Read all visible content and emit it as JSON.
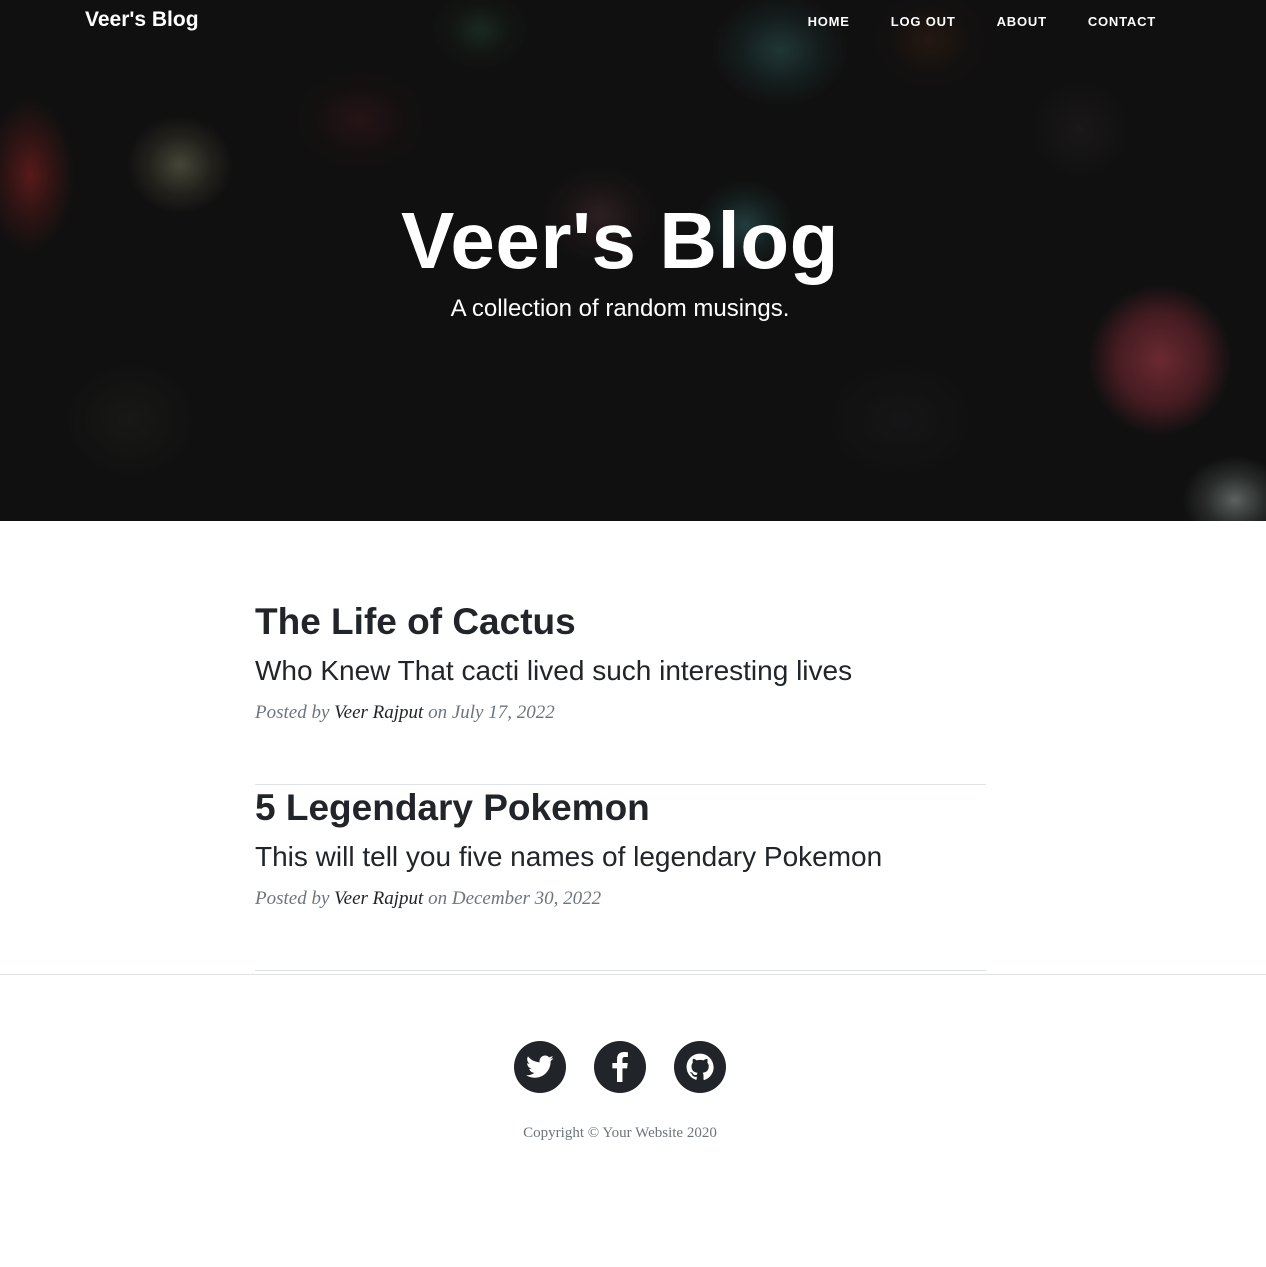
{
  "navbar": {
    "brand": "Veer's Blog",
    "links": [
      {
        "label": "HOME"
      },
      {
        "label": "LOG OUT"
      },
      {
        "label": "ABOUT"
      },
      {
        "label": "CONTACT"
      }
    ]
  },
  "hero": {
    "title": "Veer's Blog",
    "subtitle": "A collection of random musings."
  },
  "posts": [
    {
      "title": "The Life of Cactus",
      "subtitle": "Who Knew That cacti lived such interesting lives",
      "posted_by": "Posted by",
      "author": "Veer Rajput",
      "on": "on",
      "date": "July 17, 2022"
    },
    {
      "title": "5 Legendary Pokemon",
      "subtitle": "This will tell you five names of legendary Pokemon",
      "posted_by": "Posted by",
      "author": "Veer Rajput",
      "on": "on",
      "date": "December 30, 2022"
    }
  ],
  "footer": {
    "social": [
      {
        "icon": "twitter-icon"
      },
      {
        "icon": "facebook-icon"
      },
      {
        "icon": "github-icon"
      }
    ],
    "copyright": "Copyright © Your Website 2020"
  },
  "colors": {
    "text_dark": "#212529",
    "text_muted": "#6c757d",
    "divider": "#dee2e6",
    "hero_text": "#ffffff"
  }
}
